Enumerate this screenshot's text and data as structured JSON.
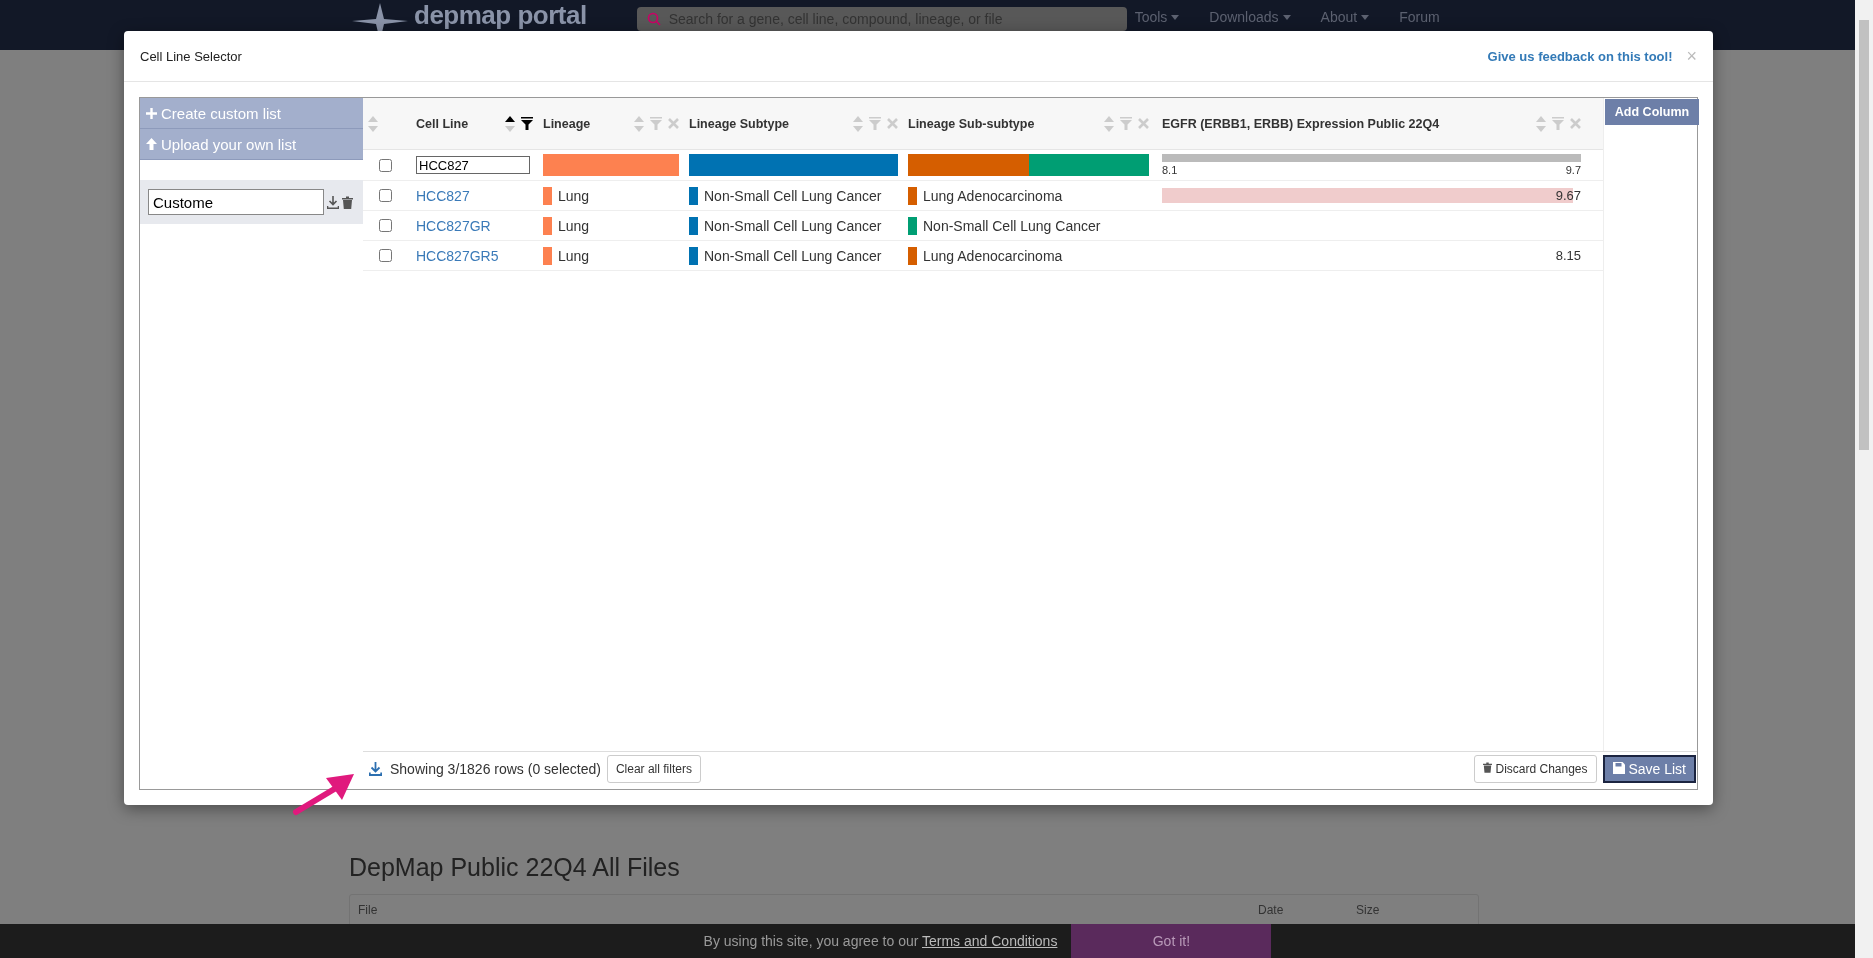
{
  "page": {
    "logo": "depmap portal",
    "search": {
      "placeholder": "Search for a gene, cell line, compound, lineage, or file"
    },
    "nav": [
      {
        "label": "Tools",
        "dropdown": true
      },
      {
        "label": "Downloads",
        "dropdown": true
      },
      {
        "label": "About",
        "dropdown": true
      },
      {
        "label": "Forum",
        "dropdown": false
      }
    ],
    "section_title": "DepMap Public 22Q4 All Files",
    "file_table_columns": [
      "File",
      "Date",
      "Size"
    ]
  },
  "modal": {
    "title": "Cell Line Selector",
    "feedback_link": "Give us feedback on this tool!",
    "close": "×",
    "sidebar": {
      "buttons": [
        {
          "label": "Create custom list",
          "kind": "plus"
        },
        {
          "label": "Upload your own list",
          "kind": "upload"
        }
      ],
      "list_name": "Custome"
    },
    "table": {
      "select_all": {
        "checked": false
      },
      "columns": [
        {
          "label": "Cell Line",
          "sorted": true,
          "filter_active": true,
          "removable": false
        },
        {
          "label": "Lineage",
          "sorted": false,
          "filter_active": false,
          "removable": true
        },
        {
          "label": "Lineage Subtype",
          "sorted": false,
          "filter_active": false,
          "removable": true
        },
        {
          "label": "Lineage Sub-subtype",
          "sorted": false,
          "filter_active": false,
          "removable": true
        },
        {
          "label": "EGFR (ERBB1, ERBB) Expression Public 22Q4",
          "sorted": false,
          "filter_active": false,
          "removable": true
        }
      ],
      "filter_row": {
        "cell_line": "HCC827",
        "lineage": [
          {
            "color": "#fd8150"
          }
        ],
        "subtype": [
          {
            "color": "#0072b2"
          }
        ],
        "subsubtype": [
          {
            "color": "#d55e00"
          },
          {
            "color": "#009e73"
          }
        ],
        "range": {
          "min": "8.1",
          "max": "9.7",
          "level": 1
        }
      },
      "rows": [
        {
          "checked": false,
          "cell_line": "HCC827",
          "lineage": {
            "text": "Lung",
            "color": "#fd8150"
          },
          "subtype": {
            "text": "Non-Small Cell Lung Cancer",
            "color": "#0072b2"
          },
          "subsubtype": {
            "text": "Lung Adenocarcinoma",
            "color": "#d55e00"
          },
          "egfr": {
            "value": "9.67",
            "level": 0.98
          }
        },
        {
          "checked": false,
          "cell_line": "HCC827GR",
          "lineage": {
            "text": "Lung",
            "color": "#fd8150"
          },
          "subtype": {
            "text": "Non-Small Cell Lung Cancer",
            "color": "#0072b2"
          },
          "subsubtype": {
            "text": "Non-Small Cell Lung Cancer",
            "color": "#009e73"
          }
        },
        {
          "checked": false,
          "cell_line": "HCC827GR5",
          "lineage": {
            "text": "Lung",
            "color": "#fd8150"
          },
          "subtype": {
            "text": "Non-Small Cell Lung Cancer",
            "color": "#0072b2"
          },
          "subsubtype": {
            "text": "Lung Adenocarcinoma",
            "color": "#d55e00"
          },
          "egfr": {
            "value": "8.15"
          }
        }
      ]
    },
    "add_column": "Add Column",
    "footer": {
      "status": "Showing 3/1826 rows (0 selected)",
      "clear": "Clear all filters",
      "discard": "Discard Changes",
      "save": "Save List"
    }
  },
  "cookie_banner": {
    "text": "By using this site, you agree to our",
    "link": "Terms and Conditions",
    "button": "Got it!"
  }
}
